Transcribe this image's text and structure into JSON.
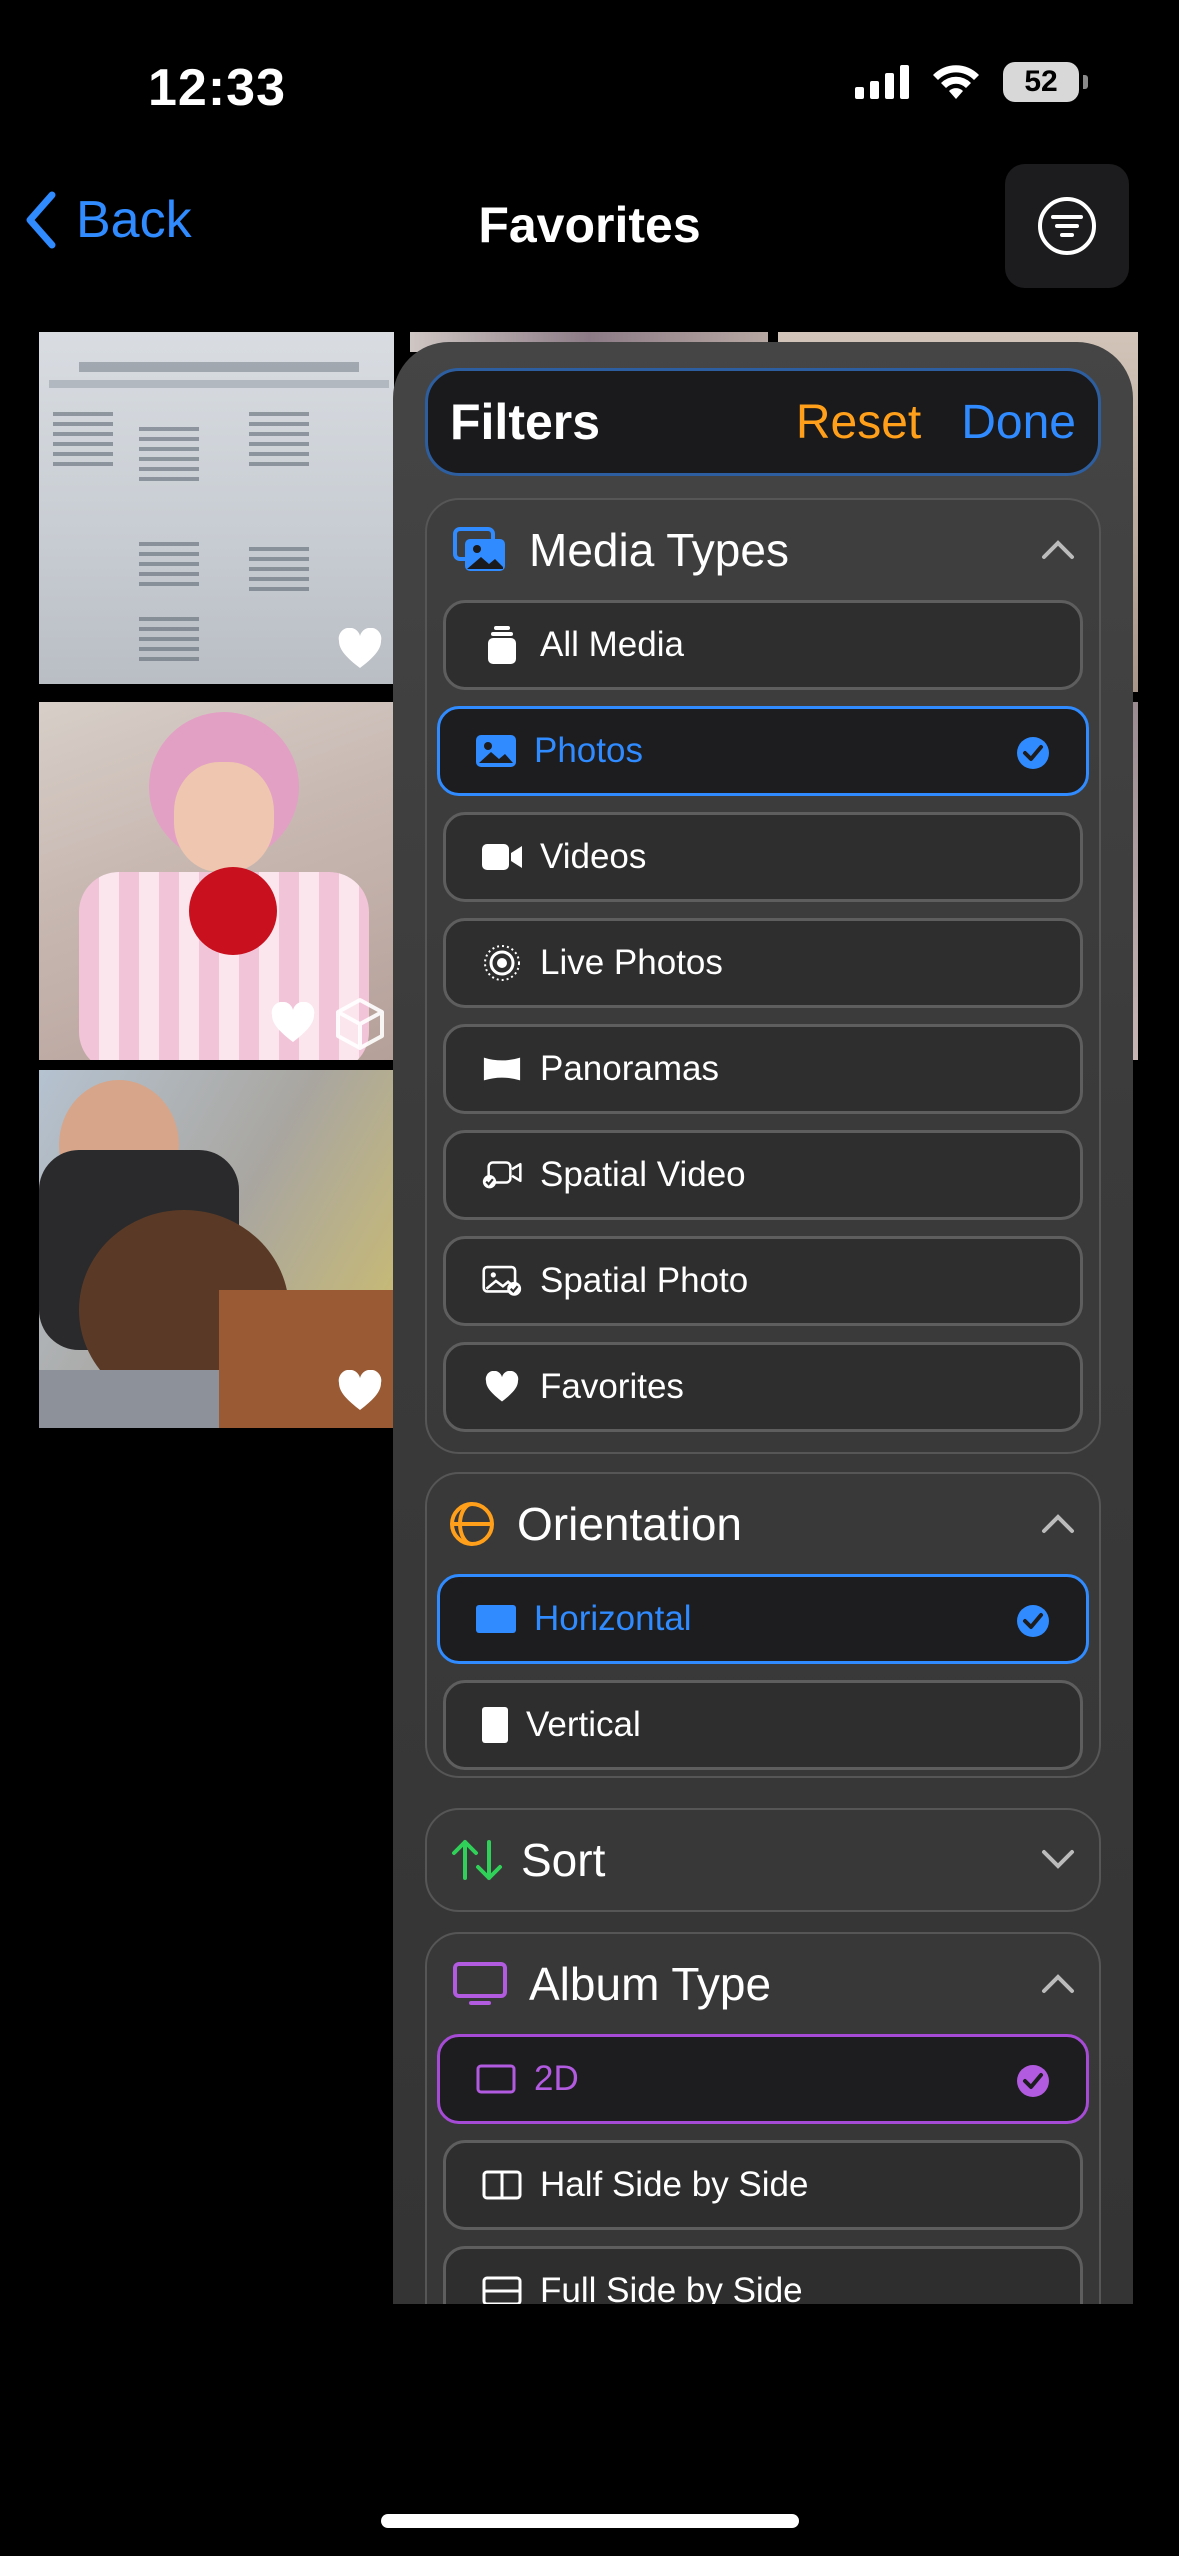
{
  "status": {
    "time": "12:33",
    "battery": "52"
  },
  "nav": {
    "back_label": "Back",
    "title": "Favorites"
  },
  "filters": {
    "title": "Filters",
    "reset_label": "Reset",
    "done_label": "Done",
    "media_types": {
      "title": "Media Types",
      "options": [
        {
          "label": "All Media",
          "selected": false
        },
        {
          "label": "Photos",
          "selected": true
        },
        {
          "label": "Videos",
          "selected": false
        },
        {
          "label": "Live Photos",
          "selected": false
        },
        {
          "label": "Panoramas",
          "selected": false
        },
        {
          "label": "Spatial Video",
          "selected": false
        },
        {
          "label": "Spatial Photo",
          "selected": false
        },
        {
          "label": "Favorites",
          "selected": false
        }
      ]
    },
    "orientation": {
      "title": "Orientation",
      "options": [
        {
          "label": "Horizontal",
          "selected": true
        },
        {
          "label": "Vertical",
          "selected": false
        }
      ]
    },
    "sort": {
      "title": "Sort",
      "expanded": false
    },
    "album_type": {
      "title": "Album Type",
      "options": [
        {
          "label": "2D",
          "selected": true
        },
        {
          "label": "Half Side by Side",
          "selected": false
        },
        {
          "label": "Full Side by Side",
          "selected": false
        }
      ]
    }
  },
  "colors": {
    "accent_blue": "#2f8bff",
    "reset_orange": "#ff9f1a",
    "orientation_orange": "#ff9f1a",
    "sort_green": "#30d158",
    "album_purple": "#b25ae0"
  }
}
